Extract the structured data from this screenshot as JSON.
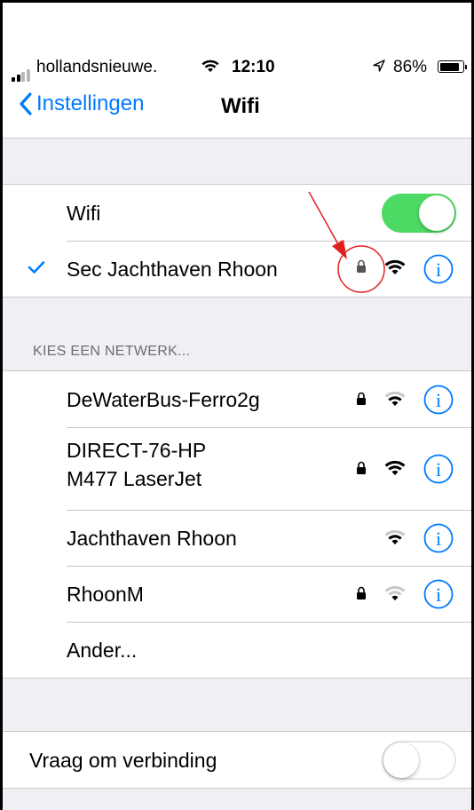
{
  "status_bar": {
    "carrier": "hollandsnieuwe.",
    "time": "12:10",
    "battery": "86%",
    "battery_level": 0.86
  },
  "nav": {
    "back_label": "Instellingen",
    "title": "Wifi"
  },
  "wifi_toggle": {
    "label": "Wifi",
    "on": true
  },
  "connected_network": {
    "name": "Sec Jachthaven Rhoon",
    "secured": true
  },
  "networks_header": "KIES EEN NETWERK...",
  "networks": [
    {
      "name": "DeWaterBus-Ferro2g",
      "secured": true
    },
    {
      "name_line1": "DIRECT-76-HP",
      "name_line2": "M477 LaserJet",
      "secured": true
    },
    {
      "name": "Jachthaven Rhoon",
      "secured": false
    },
    {
      "name": "RhoonM",
      "secured": true
    }
  ],
  "other_label": "Ander...",
  "ask_to_join": {
    "label": "Vraag om verbinding",
    "on": false
  },
  "icons": {
    "back": "chevron-left-icon",
    "check": "checkmark-icon",
    "lock": "lock-icon",
    "wifi": "wifi-icon",
    "info": "info-icon"
  },
  "colors": {
    "accent": "#007aff",
    "toggle_on": "#4cd964",
    "annotation": "#e02020"
  }
}
